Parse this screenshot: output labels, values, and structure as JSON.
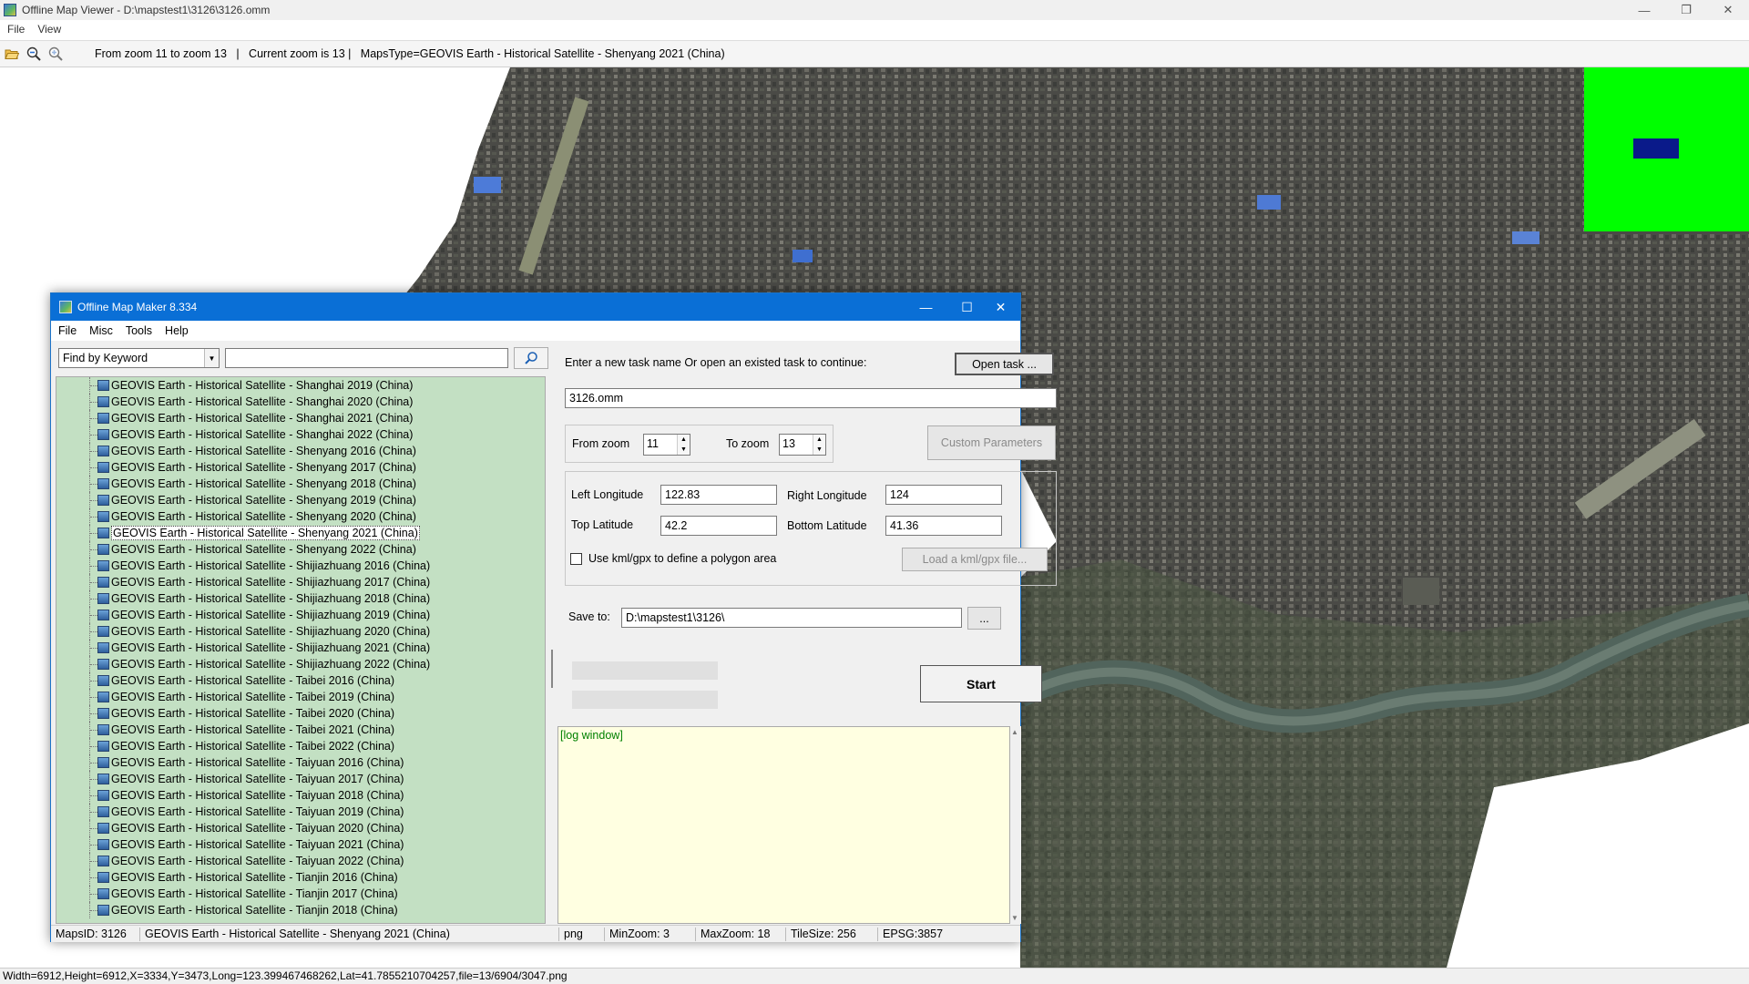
{
  "viewer": {
    "title": "Offline Map Viewer - D:\\mapstest1\\3126\\3126.omm",
    "menu": [
      "File",
      "View"
    ],
    "toolbar_status": "From zoom 11 to zoom 13   |   Current zoom is 13 |   MapsType=GEOVIS Earth - Historical Satellite - Shenyang 2021 (China)",
    "statusbar": "Width=6912,Height=6912,X=3334,Y=3473,Long=123.399467468262,Lat=41.7855210704257,file=13/6904/3047.png",
    "controls": {
      "minimize": "—",
      "restore": "❐",
      "close": "✕"
    }
  },
  "maker": {
    "title": "Offline Map Maker 8.334",
    "menu": [
      "File",
      "Misc",
      "Tools",
      "Help"
    ],
    "controls": {
      "minimize": "—",
      "maximize": "☐",
      "close": "✕"
    },
    "find_mode": "Find by Keyword",
    "search_value": "",
    "list_items": [
      "GEOVIS Earth - Historical Satellite - Shanghai 2019 (China)",
      "GEOVIS Earth - Historical Satellite - Shanghai 2020 (China)",
      "GEOVIS Earth - Historical Satellite - Shanghai 2021 (China)",
      "GEOVIS Earth - Historical Satellite - Shanghai 2022 (China)",
      "GEOVIS Earth - Historical Satellite - Shenyang 2016 (China)",
      "GEOVIS Earth - Historical Satellite - Shenyang 2017 (China)",
      "GEOVIS Earth - Historical Satellite - Shenyang 2018 (China)",
      "GEOVIS Earth - Historical Satellite - Shenyang 2019 (China)",
      "GEOVIS Earth - Historical Satellite - Shenyang 2020 (China)",
      "GEOVIS Earth - Historical Satellite - Shenyang 2021 (China)",
      "GEOVIS Earth - Historical Satellite - Shenyang 2022 (China)",
      "GEOVIS Earth - Historical Satellite - Shijiazhuang 2016 (China)",
      "GEOVIS Earth - Historical Satellite - Shijiazhuang 2017 (China)",
      "GEOVIS Earth - Historical Satellite - Shijiazhuang 2018 (China)",
      "GEOVIS Earth - Historical Satellite - Shijiazhuang 2019 (China)",
      "GEOVIS Earth - Historical Satellite - Shijiazhuang 2020 (China)",
      "GEOVIS Earth - Historical Satellite - Shijiazhuang 2021 (China)",
      "GEOVIS Earth - Historical Satellite - Shijiazhuang 2022 (China)",
      "GEOVIS Earth - Historical Satellite - Taibei 2016 (China)",
      "GEOVIS Earth - Historical Satellite - Taibei 2019 (China)",
      "GEOVIS Earth - Historical Satellite - Taibei 2020 (China)",
      "GEOVIS Earth - Historical Satellite - Taibei 2021 (China)",
      "GEOVIS Earth - Historical Satellite - Taibei 2022 (China)",
      "GEOVIS Earth - Historical Satellite - Taiyuan 2016 (China)",
      "GEOVIS Earth - Historical Satellite - Taiyuan 2017 (China)",
      "GEOVIS Earth - Historical Satellite - Taiyuan 2018 (China)",
      "GEOVIS Earth - Historical Satellite - Taiyuan 2019 (China)",
      "GEOVIS Earth - Historical Satellite - Taiyuan 2020 (China)",
      "GEOVIS Earth - Historical Satellite - Taiyuan 2021 (China)",
      "GEOVIS Earth - Historical Satellite - Taiyuan 2022 (China)",
      "GEOVIS Earth - Historical Satellite - Tianjin 2016 (China)",
      "GEOVIS Earth - Historical Satellite - Tianjin 2017 (China)",
      "GEOVIS Earth - Historical Satellite - Tianjin 2018 (China)"
    ],
    "selected_item": "GEOVIS Earth - Historical Satellite - Shenyang 2021 (China)",
    "task_prompt": "Enter a new task name Or open an existed task to continue:",
    "open_task_label": "Open task ...",
    "task_name": "3126.omm",
    "from_zoom_label": "From zoom",
    "from_zoom": "11",
    "to_zoom_label": "To zoom",
    "to_zoom": "13",
    "custom_params_label": "Custom Parameters",
    "left_lon_label": "Left Longitude",
    "left_lon": "122.83",
    "right_lon_label": "Right Longitude",
    "right_lon": "124",
    "top_lat_label": "Top Latitude",
    "top_lat": "42.2",
    "bottom_lat_label": "Bottom Latitude",
    "bottom_lat": "41.36",
    "kml_label": "Use kml/gpx to define a polygon area",
    "load_kml_label": "Load a kml/gpx file...",
    "save_to_label": "Save to:",
    "save_to": "D:\\mapstest1\\3126\\",
    "browse_label": "...",
    "start_label": "Start",
    "log_title": "[log window]",
    "status": {
      "maps_id": "MapsID: 3126",
      "maps_name": "GEOVIS Earth - Historical Satellite - Shenyang 2021 (China)",
      "format": "png",
      "min_zoom": "MinZoom: 3",
      "max_zoom": "MaxZoom: 18",
      "tile_size": "TileSize: 256",
      "epsg": "EPSG:3857"
    }
  },
  "colors": {
    "minimap_bg": "#00ff00",
    "minimap_view": "#0a1a8a",
    "list_bg": "#c3e0c3",
    "log_bg": "#ffffe1",
    "titlebar_blue": "#0a6fd6"
  }
}
